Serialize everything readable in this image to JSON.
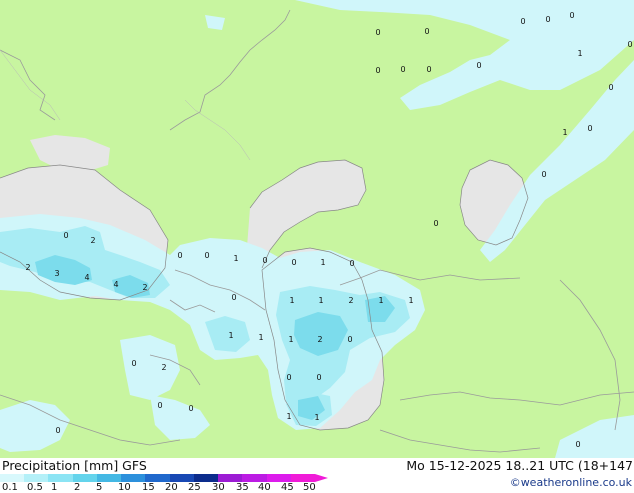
{
  "title": {
    "left": "Precipitation [mm]  GFS",
    "right": "Mo 15-12-2025 18..21 UTC (18+147"
  },
  "copyright": "©weatheronline.co.uk",
  "legend": {
    "labels": [
      "0.1",
      "0.5",
      "1",
      "2",
      "5",
      "10",
      "15",
      "20",
      "25",
      "30",
      "35",
      "40",
      "45",
      "50"
    ],
    "colors": [
      "#d8f8fc",
      "#b4f0f8",
      "#8ce4f4",
      "#64d4ec",
      "#44b8e4",
      "#2c90dc",
      "#2068cc",
      "#1848b4",
      "#0c2c8c",
      "#9c1cd4",
      "#bc1ce4",
      "#dc1cec",
      "#f01cd8"
    ]
  },
  "colors": {
    "land": "#c8f5a0",
    "sea": "#e6e6e6",
    "precip_light": "#d0f6fa",
    "precip_mid": "#a8ecf4",
    "precip_heavy": "#7cdcec"
  },
  "map_labels": [
    {
      "t": "0"
    },
    {
      "t": "0"
    },
    {
      "t": "0"
    },
    {
      "t": "0"
    },
    {
      "t": "0"
    },
    {
      "t": "0"
    },
    {
      "t": "0"
    },
    {
      "t": "0"
    },
    {
      "t": "0"
    },
    {
      "t": "0"
    },
    {
      "t": "1"
    },
    {
      "t": "0"
    },
    {
      "t": "1"
    },
    {
      "t": "0"
    },
    {
      "t": "0"
    },
    {
      "t": "2"
    },
    {
      "t": "2"
    },
    {
      "t": "3"
    },
    {
      "t": "4"
    },
    {
      "t": "4"
    },
    {
      "t": "2"
    },
    {
      "t": "0"
    },
    {
      "t": "0"
    },
    {
      "t": "1"
    },
    {
      "t": "0"
    },
    {
      "t": "0"
    },
    {
      "t": "1"
    },
    {
      "t": "0"
    },
    {
      "t": "0"
    },
    {
      "t": "0"
    },
    {
      "t": "1"
    },
    {
      "t": "1"
    },
    {
      "t": "2"
    },
    {
      "t": "1"
    },
    {
      "t": "1"
    },
    {
      "t": "1"
    },
    {
      "t": "1"
    },
    {
      "t": "1"
    },
    {
      "t": "2"
    },
    {
      "t": "0"
    },
    {
      "t": "0"
    },
    {
      "t": "2"
    },
    {
      "t": "0"
    },
    {
      "t": "0"
    },
    {
      "t": "0"
    },
    {
      "t": "0"
    },
    {
      "t": "0"
    },
    {
      "t": "1"
    },
    {
      "t": "1"
    },
    {
      "t": "0"
    },
    {
      "t": "0"
    }
  ]
}
